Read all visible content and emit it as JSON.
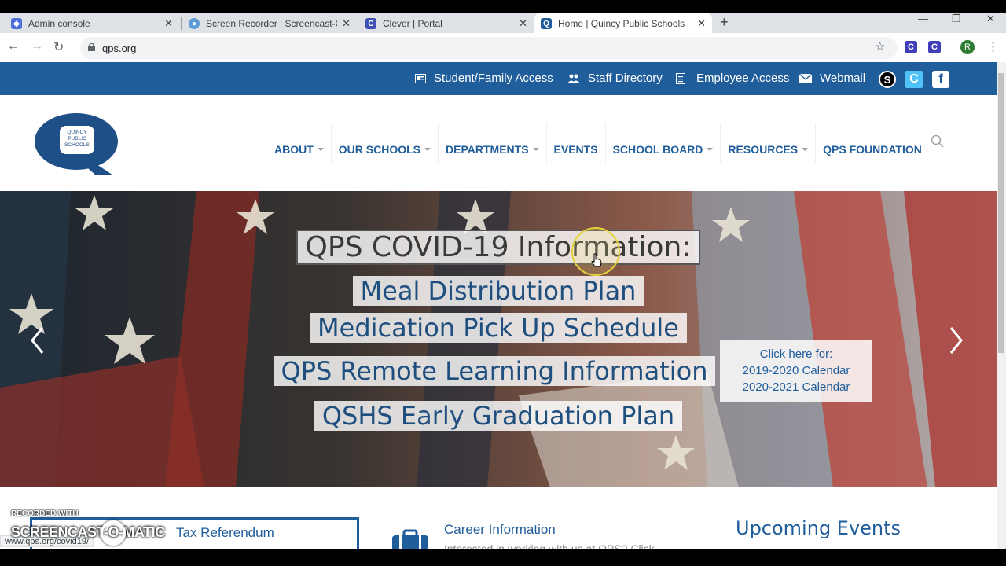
{
  "browser": {
    "tabs": [
      {
        "title": "Admin console",
        "color": "#4a6fd6"
      },
      {
        "title": "Screen Recorder | Screencast-O-",
        "color": "#5b9bd5"
      },
      {
        "title": "Clever | Portal",
        "color": "#3f51b5"
      },
      {
        "title": "Home | Quincy Public Schools",
        "color": "#1f5d9b"
      }
    ],
    "active_tab_index": 3,
    "new_tab_glyph": "+",
    "url": "qps.org",
    "extension_letters": [
      "C",
      "C"
    ],
    "profile_initial": "R"
  },
  "topbar": {
    "links": [
      {
        "label": "Student/Family Access",
        "icon": "id-card-icon"
      },
      {
        "label": "Staff Directory",
        "icon": "users-icon"
      },
      {
        "label": "Employee Access",
        "icon": "document-icon"
      },
      {
        "label": "Webmail",
        "icon": "envelope-icon"
      }
    ],
    "social": [
      {
        "letter": "S",
        "icon": "schoology-icon"
      },
      {
        "letter": "C",
        "icon": "clever-icon"
      },
      {
        "letter": "f",
        "icon": "facebook-icon"
      }
    ]
  },
  "logo": {
    "lines": [
      "QUINCY",
      "PUBLIC",
      "SCHOOLS"
    ],
    "letter": "Q"
  },
  "nav": [
    {
      "label": "ABOUT",
      "dropdown": true
    },
    {
      "label": "OUR SCHOOLS",
      "dropdown": true
    },
    {
      "label": "DEPARTMENTS",
      "dropdown": true
    },
    {
      "label": "EVENTS",
      "dropdown": false
    },
    {
      "label": "SCHOOL BOARD",
      "dropdown": true
    },
    {
      "label": "RESOURCES",
      "dropdown": true
    },
    {
      "label": "QPS FOUNDATION",
      "dropdown": false
    }
  ],
  "hero": {
    "title": "QPS COVID-19 Information:",
    "links": [
      "Meal Distribution Plan",
      "Medication Pick Up Schedule",
      "QPS Remote Learning Information",
      "QSHS Early Graduation Plan"
    ],
    "calendar": {
      "heading": "Click here for:",
      "items": [
        "2019-2020 Calendar",
        "2020-2021 Calendar"
      ]
    }
  },
  "bottom": {
    "tax_text": "Tax Referendum",
    "career_title": "Career Information",
    "career_sub": "Interested in working with us at QPS? Click",
    "events_title": "Upcoming Events"
  },
  "watermark": {
    "small": "RECORDED WITH",
    "big": "SCREENCAST-O-MATIC"
  },
  "status_url": "www.qps.org/covid19/",
  "colors": {
    "brand_blue": "#1f5d9b",
    "nav_blue": "#1f5d9b"
  }
}
